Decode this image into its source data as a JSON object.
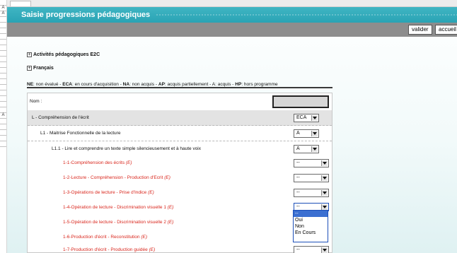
{
  "left_strip": [
    "",
    "A",
    "A",
    "",
    "",
    "",
    "",
    "",
    "",
    "",
    "",
    "",
    "",
    "",
    "",
    "",
    "",
    "",
    "",
    "",
    "A",
    "",
    "",
    "",
    "",
    ""
  ],
  "title": "Saisie progressions pédagogiques",
  "toolbar": {
    "valider": "valider",
    "accueil": "accueil"
  },
  "sections": [
    {
      "label": "Activités pédagogiques E2C",
      "icon": "plus-box-icon"
    },
    {
      "label": "Français",
      "icon": "plus-box-icon"
    }
  ],
  "legend": [
    {
      "code": "NE",
      "text": ": non évalué - "
    },
    {
      "code": "ECA",
      "text": ": en cours d'acquisition - "
    },
    {
      "code": "NA",
      "text": ": non acquis - "
    },
    {
      "code": "AP",
      "text": ": acquis partiellement - A: acquis - "
    },
    {
      "code": "HP",
      "text": ": hors programme"
    }
  ],
  "form": {
    "nom_label": "Nom :",
    "rows": [
      {
        "label": "L - Compréhension de l'écrit",
        "value": "ECA",
        "red": false
      },
      {
        "label": "L1 - Maitrise Fonctionnelle de la lecture",
        "value": "A",
        "red": false
      },
      {
        "label": "L1.1 - Lire et comprendre un texte simple silencieusement et à haute voix",
        "value": "A",
        "red": false
      },
      {
        "label": "1-1-Compréhension des écrits",
        "suffix": "(E)",
        "value": "--",
        "red": true
      },
      {
        "label": "1-2-Lecture - Compréhension - Production d'Ecrit",
        "suffix": "(E)",
        "value": "--",
        "red": true
      },
      {
        "label": "1-3-Opérations de lecture - Prise d'Indice",
        "suffix": "(E)",
        "value": "--",
        "red": true
      },
      {
        "label": "1-4-Opération de lecture - Discrimination visuelle 1",
        "suffix": "(E)",
        "value": "--",
        "red": true
      },
      {
        "label": "1-5-Opération de lecture - Discrimination visuelle 2",
        "suffix": "(E)",
        "value": "",
        "red": true
      },
      {
        "label": "1-6-Production d'écrit - Reconstitution",
        "suffix": "(E)",
        "value": "",
        "red": true
      },
      {
        "label": "1-7-Production d'écrit - Production guidée",
        "suffix": "(E)",
        "value": "--",
        "red": true
      }
    ]
  },
  "dropdown_options": [
    "--",
    "Oui",
    "Non",
    "En Cours"
  ]
}
